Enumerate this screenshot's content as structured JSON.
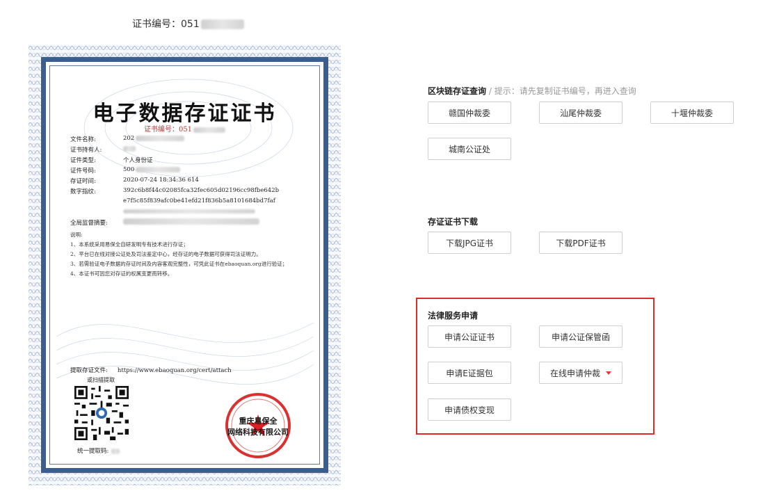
{
  "header": {
    "cert_id_label": "证书编号：051"
  },
  "certificate": {
    "title": "电子数据存证证书",
    "number": "证书编号：051",
    "rows": [
      {
        "label": "文件名称:",
        "value": "202"
      },
      {
        "label": "证书持有人:",
        "value": ""
      },
      {
        "label": "证件类型:",
        "value": "个人身份证"
      },
      {
        "label": "证件号码:",
        "value": "500"
      },
      {
        "label": "存证时间:",
        "value": "2020-07-24 18:34:36 614"
      },
      {
        "label": "数字指纹:",
        "value": "392c6b8f44c02085fca32fec605d02196cc98fbe642b"
      },
      {
        "label": "",
        "value": "e7f5c85f839afc0be41efd21f836b5a8101684bd7faf"
      }
    ],
    "supervision_label": "全局监督摘要:",
    "notes_title": "说明:",
    "notes": [
      "1、本系统采用易保全自研发明专有技术进行存证；",
      "2、平台已在线对接公证处及司法鉴定中心，经存证的电子数据可获得司法证明力。",
      "3、若需验证电子数据的存证时间及内容客观完整性，可凭此证书在ebaoquan.org进行验证；",
      "4、本证书可因您对存证的权属变更而转移。"
    ],
    "extract_label": "提取存证文件:",
    "extract_url": "https://www.ebaoquan.org/cert/attach",
    "scan_label": "或扫描提取",
    "id_code_label": "统一提取码:",
    "seal_text": [
      "重庆易保全",
      "网络科技有限公司"
    ]
  },
  "blockchain": {
    "title": "区块链存证查询",
    "hint": " / 提示：请先复制证书编号，再进入查询",
    "buttons": [
      "赣国仲裁委",
      "汕尾仲裁委",
      "十堰仲裁委",
      "城南公证处"
    ]
  },
  "download": {
    "title": "存证证书下载",
    "buttons": [
      "下载JPG证书",
      "下载PDF证书"
    ]
  },
  "legal": {
    "title": "法律服务申请",
    "buttons": [
      "申请公证证书",
      "申请公证保管函",
      "申请E证据包",
      "在线申请仲裁",
      "申请债权变现"
    ],
    "highlight_color": "#e02a2a"
  }
}
